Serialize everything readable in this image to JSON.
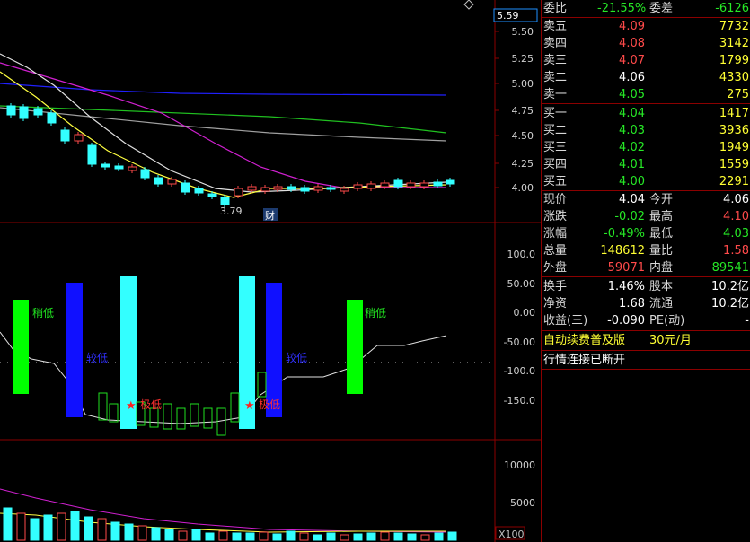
{
  "price_scale": {
    "current": "5.59",
    "ticks": [
      "5.50",
      "5.25",
      "5.00",
      "4.75",
      "4.50",
      "4.25",
      "4.00"
    ]
  },
  "low_marker": "3.79",
  "cai_badge": "财",
  "indicator": {
    "ticks": [
      "100.0",
      "50.00",
      "0.00",
      "-50.00",
      "-100.0",
      "-150.0"
    ],
    "labels": [
      "稍低",
      "较低",
      "极低",
      "极低",
      "较低",
      "稍低"
    ]
  },
  "volume": {
    "ticks": [
      "10000",
      "5000"
    ],
    "unit": "X100"
  },
  "top_icon": "diamond-icon",
  "quote": {
    "wb": {
      "label": "委比",
      "value": "-21.55%",
      "label2": "委差",
      "value2": "-6126"
    },
    "asks": [
      {
        "label": "卖五",
        "price": "4.09",
        "vol": "7732"
      },
      {
        "label": "卖四",
        "price": "4.08",
        "vol": "3142"
      },
      {
        "label": "卖三",
        "price": "4.07",
        "vol": "1799"
      },
      {
        "label": "卖二",
        "price": "4.06",
        "vol": "4330"
      },
      {
        "label": "卖一",
        "price": "4.05",
        "vol": "275"
      }
    ],
    "bids": [
      {
        "label": "买一",
        "price": "4.04",
        "vol": "1417"
      },
      {
        "label": "买二",
        "price": "4.03",
        "vol": "3936"
      },
      {
        "label": "买三",
        "price": "4.02",
        "vol": "1949"
      },
      {
        "label": "买四",
        "price": "4.01",
        "vol": "1559"
      },
      {
        "label": "买五",
        "price": "4.00",
        "vol": "2291"
      }
    ],
    "stats1": [
      {
        "l1": "现价",
        "v1": "4.04",
        "l2": "今开",
        "v2": "4.06"
      },
      {
        "l1": "涨跌",
        "v1": "-0.02",
        "l2": "最高",
        "v2": "4.10"
      },
      {
        "l1": "涨幅",
        "v1": "-0.49%",
        "l2": "最低",
        "v2": "4.03"
      },
      {
        "l1": "总量",
        "v1": "148612",
        "l2": "量比",
        "v2": "1.58"
      },
      {
        "l1": "外盘",
        "v1": "59071",
        "l2": "内盘",
        "v2": "89541"
      }
    ],
    "stats2": [
      {
        "l1": "换手",
        "v1": "1.46%",
        "l2": "股本",
        "v2": "10.2亿"
      },
      {
        "l1": "净资",
        "v1": "1.68",
        "l2": "流通",
        "v2": "10.2亿"
      },
      {
        "l1": "收益(三)",
        "v1": "-0.090",
        "l2": "PE(动)",
        "v2": "-"
      }
    ],
    "promo": "自动续费普及版",
    "promo_price": "30元/月",
    "status": "行情连接已断开"
  },
  "colors": {
    "up": "#ff4a4a",
    "down": "#26e826",
    "grid": "#8b0000",
    "cyan": "#33ffff",
    "blue": "#1010ff",
    "green": "#00ff00"
  }
}
